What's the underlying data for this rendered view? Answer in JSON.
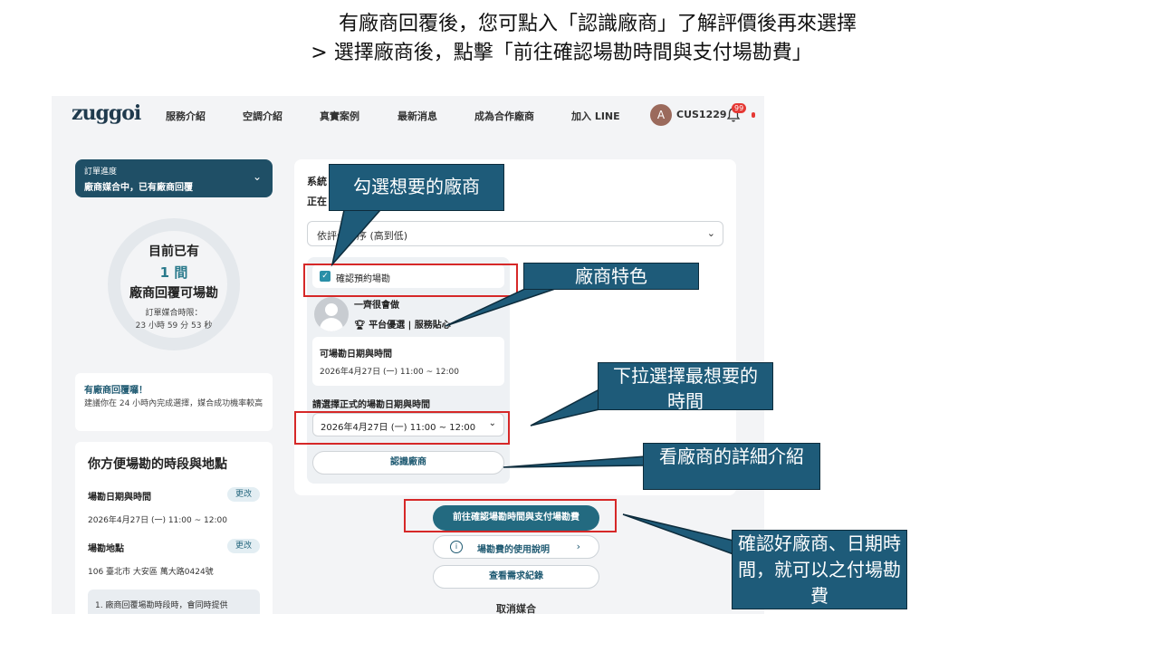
{
  "slide": {
    "title_line1": "有廠商回覆後，您可點入「認識廠商」了解評價後再來選擇",
    "title_line2": "> 選擇廠商後，點擊「前往確認場勘時間與支付場勘費」"
  },
  "nav": {
    "logo": "zuggoi",
    "links": [
      "服務介紹",
      "空調介紹",
      "真實案例",
      "最新消息",
      "成為合作廠商",
      "加入 LINE"
    ],
    "avatar_letter": "A",
    "user": "CUS1229",
    "notification_count": "99"
  },
  "progress": {
    "label": "訂單進度",
    "status": "廠商媒合中，已有廠商回覆"
  },
  "summary": {
    "line1": "目前已有",
    "count": "1 間",
    "line3": "廠商回覆可場勘",
    "deadline_label": "訂單媒合時限：",
    "deadline_value": "23 小時 59 分 53 秒"
  },
  "notice": {
    "title": "有廠商回覆囉！",
    "body": "建議你在 24 小時內完成選擇，媒合成功機率較高"
  },
  "schedule": {
    "title": "你方便場勘的時段與地點",
    "date_label": "場勘日期與時間",
    "date_value": "2026年4月27日 (一) 11:00 ~ 12:00",
    "location_label": "場勘地點",
    "location_value": "106 臺北市 大安區 萬大路0424號",
    "change_label": "更改",
    "note": "1. 廠商回覆場勘時段時，會同時提供"
  },
  "main": {
    "sys_label": "系統",
    "sys_label2": "正在",
    "sort_value": "依評分排序 (高到低)",
    "vendor": {
      "confirm_label": "確認預約場勘",
      "name": "一齊很會做",
      "features": "平台優選 | 服務貼心",
      "available_label": "可場勘日期與時間",
      "available_value": "2026年4月27日 (一)  11:00 ~ 12:00",
      "pick_label": "請選擇正式的場勘日期與時間",
      "pick_value": "2026年4月27日 (一) 11:00 ~ 12:00",
      "know_button": "認識廠商"
    },
    "cta": "前往確認場勘時間與支付場勘費",
    "fee_button": "場勘費的使用說明",
    "history_button": "查看需求紀錄",
    "cancel": "取消媒合"
  },
  "callouts": {
    "select_vendor": "勾選想要的廠商",
    "vendor_feature": "廠商特色",
    "dropdown_time": "下拉選擇最想要的時間",
    "vendor_detail": "看廠商的詳細介紹",
    "confirm_pay": "確認好廠商、日期時間，就可以之付場勘費"
  },
  "colors": {
    "brand": "#236a80",
    "callout_bg": "#1e5b79",
    "highlight": "#d62828"
  }
}
